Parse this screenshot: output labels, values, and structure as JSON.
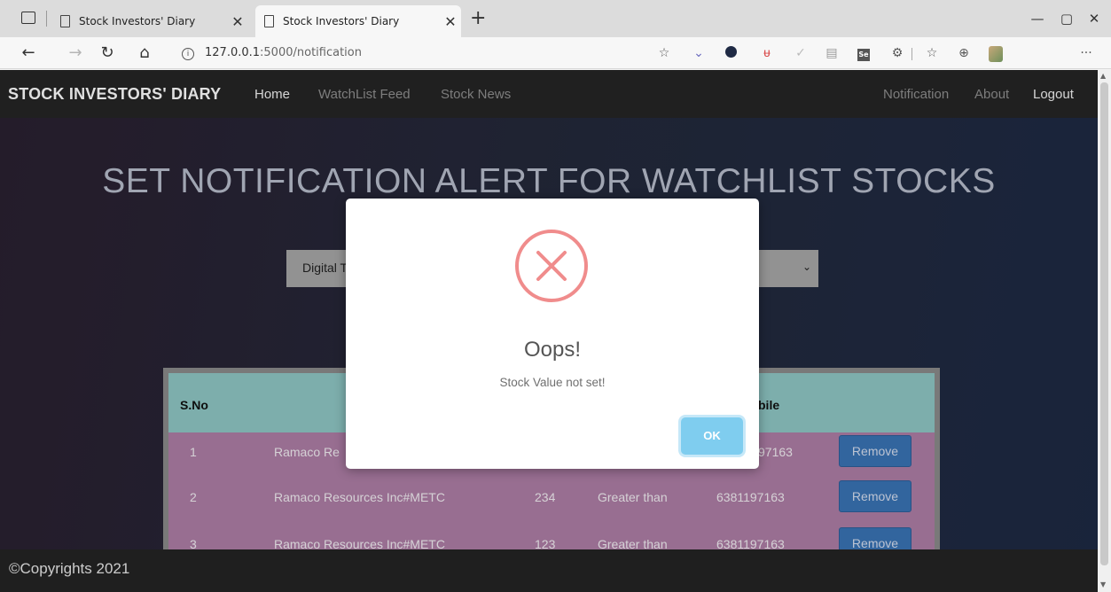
{
  "browser": {
    "tabs": [
      {
        "title": "Stock Investors' Diary",
        "close": "✕"
      },
      {
        "title": "Stock Investors' Diary",
        "close": "✕"
      }
    ],
    "new_tab": "+",
    "address": {
      "host": "127.0.0.1",
      "path": ":5000/notification"
    },
    "window_controls": {
      "minimize": "—",
      "maximize": "▢",
      "close": "✕"
    },
    "more_menu": "···"
  },
  "navbar": {
    "brand": "STOCK INVESTORS' DIARY",
    "links": [
      "Home",
      "WatchList Feed",
      "Stock News"
    ],
    "right_links": [
      "Notification",
      "About",
      "Logout"
    ]
  },
  "page": {
    "heading": "SET NOTIFICATION ALERT FOR WATCHLIST STOCKS",
    "select_value": "Digital T"
  },
  "table": {
    "headers": {
      "sno": "S.No",
      "mobile": "bile"
    },
    "rows": [
      {
        "sno": "1",
        "stock": "Ramaco Re",
        "value": "",
        "condition": "",
        "mobile": "97163",
        "action": "Remove"
      },
      {
        "sno": "2",
        "stock": "Ramaco Resources Inc#METC",
        "value": "234",
        "condition": "Greater than",
        "mobile": "6381197163",
        "action": "Remove"
      },
      {
        "sno": "3",
        "stock": "Ramaco Resources Inc#METC",
        "value": "123",
        "condition": "Greater than",
        "mobile": "6381197163",
        "action": "Remove"
      }
    ]
  },
  "footer": {
    "text": "©Copyrights 2021"
  },
  "modal": {
    "title": "Oops!",
    "message": "Stock Value not set!",
    "ok_label": "OK"
  },
  "colors": {
    "navbar_bg": "#252525",
    "table_header_bg": "#8fc7c4",
    "table_body_bg": "#ad7ea6",
    "remove_button": "#3a73b4",
    "ok_button": "#7fcdef",
    "error_icon": "#f08c8c"
  }
}
